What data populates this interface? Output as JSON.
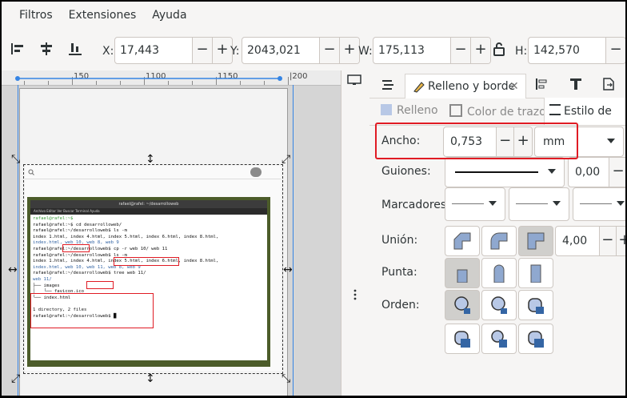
{
  "menu": [
    "Filtros",
    "Extensiones",
    "Ayuda"
  ],
  "toolbar": {
    "x_label": "X:",
    "x_value": "17,443",
    "y_label": "Y:",
    "y_value": "2043,021",
    "w_label": "W:",
    "w_value": "175,113",
    "h_label": "H:",
    "h_value": "142,570",
    "minus": "−",
    "plus": "+"
  },
  "ruler": {
    "labels": [
      "150",
      "1100",
      "1150",
      "|200"
    ]
  },
  "terminal": {
    "title": "rafael@rafel: ~/desarrolloweb",
    "menu": "Archivo  Editar  Ver  Buscar  Terminal  Ayuda",
    "lines": [
      "rafael@rafel:~$",
      "rafael@rafel:~$ cd desarrolloweb/",
      "rafael@rafel:~/desarrolloweb$ ls -m",
      "index 1.html, index 4.html, index 5.html, index 6.html, index 8.html,",
      "index.html, web 10, web 8, web 9",
      "rafael@rafel:~/desarrolloweb$ cp -r web 10/ web 11",
      "rafael@rafel:~/desarrolloweb$ ls -m",
      "index 1.html, index 4.html, index 5.html, index 6.html, index 8.html,",
      "index.html, web 10, web 11, web 8, web 9",
      "rafael@rafel:~/desarrolloweb$ tree web 11/",
      "web 11/",
      "├── images",
      "│   └── favicon.ico",
      "└── index.html",
      "",
      "1 directory, 2 files",
      "rafael@rafel:~/desarrolloweb$ █"
    ]
  },
  "panel": {
    "dock_tab": "Relleno y borde",
    "close": "✕",
    "subtabs": [
      "Relleno",
      "Color de trazo",
      "Estilo de trazo"
    ],
    "ancho_label": "Ancho:",
    "ancho_value": "0,753",
    "unit": "mm",
    "guiones_label": "Guiones:",
    "guiones_value": "0,00",
    "marcadores_label": "Marcadores:",
    "union_label": "Unión:",
    "union_value": "4,00",
    "punta_label": "Punta:",
    "orden_label": "Orden:"
  }
}
